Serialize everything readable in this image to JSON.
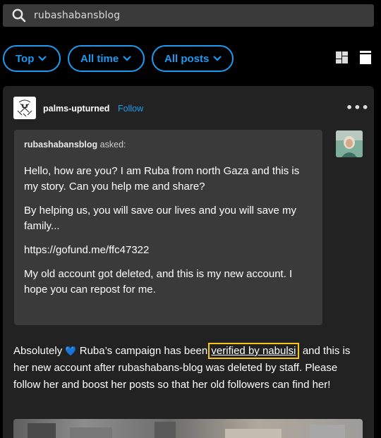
{
  "search": {
    "value": "rubashabansblog"
  },
  "filters": [
    {
      "label": "Top"
    },
    {
      "label": "All time"
    },
    {
      "label": "All posts"
    }
  ],
  "post": {
    "author": "palms-upturned",
    "follow_label": "Follow",
    "more_label": "•••",
    "ask": {
      "asker": "rubashabansblog",
      "asked_label": " asked:",
      "paragraphs": [
        "Hello, how are you? I am Ruba from north Gaza and this is my story. Can you  help me and share?",
        "By helping us, you will save our lives and you will save my family...",
        "https://gofund.me/ffc47322",
        "My old account got deleted, and this is my new account. I hope you can repost for me."
      ]
    },
    "body": {
      "prefix": "Absolutely ",
      "heart": "💙",
      "mid": " Ruba’s campaign has been ",
      "link": "verified by nabulsi",
      "suffix": ", and this is her new account after rubashabans-blog was deleted by staff. Please follow her and boost her posts so that her old followers can find her!"
    }
  },
  "colors": {
    "accent": "#1d9bf0",
    "card": "#222222",
    "ask_bg": "#3a3a3a",
    "highlight": "#f5c518"
  }
}
